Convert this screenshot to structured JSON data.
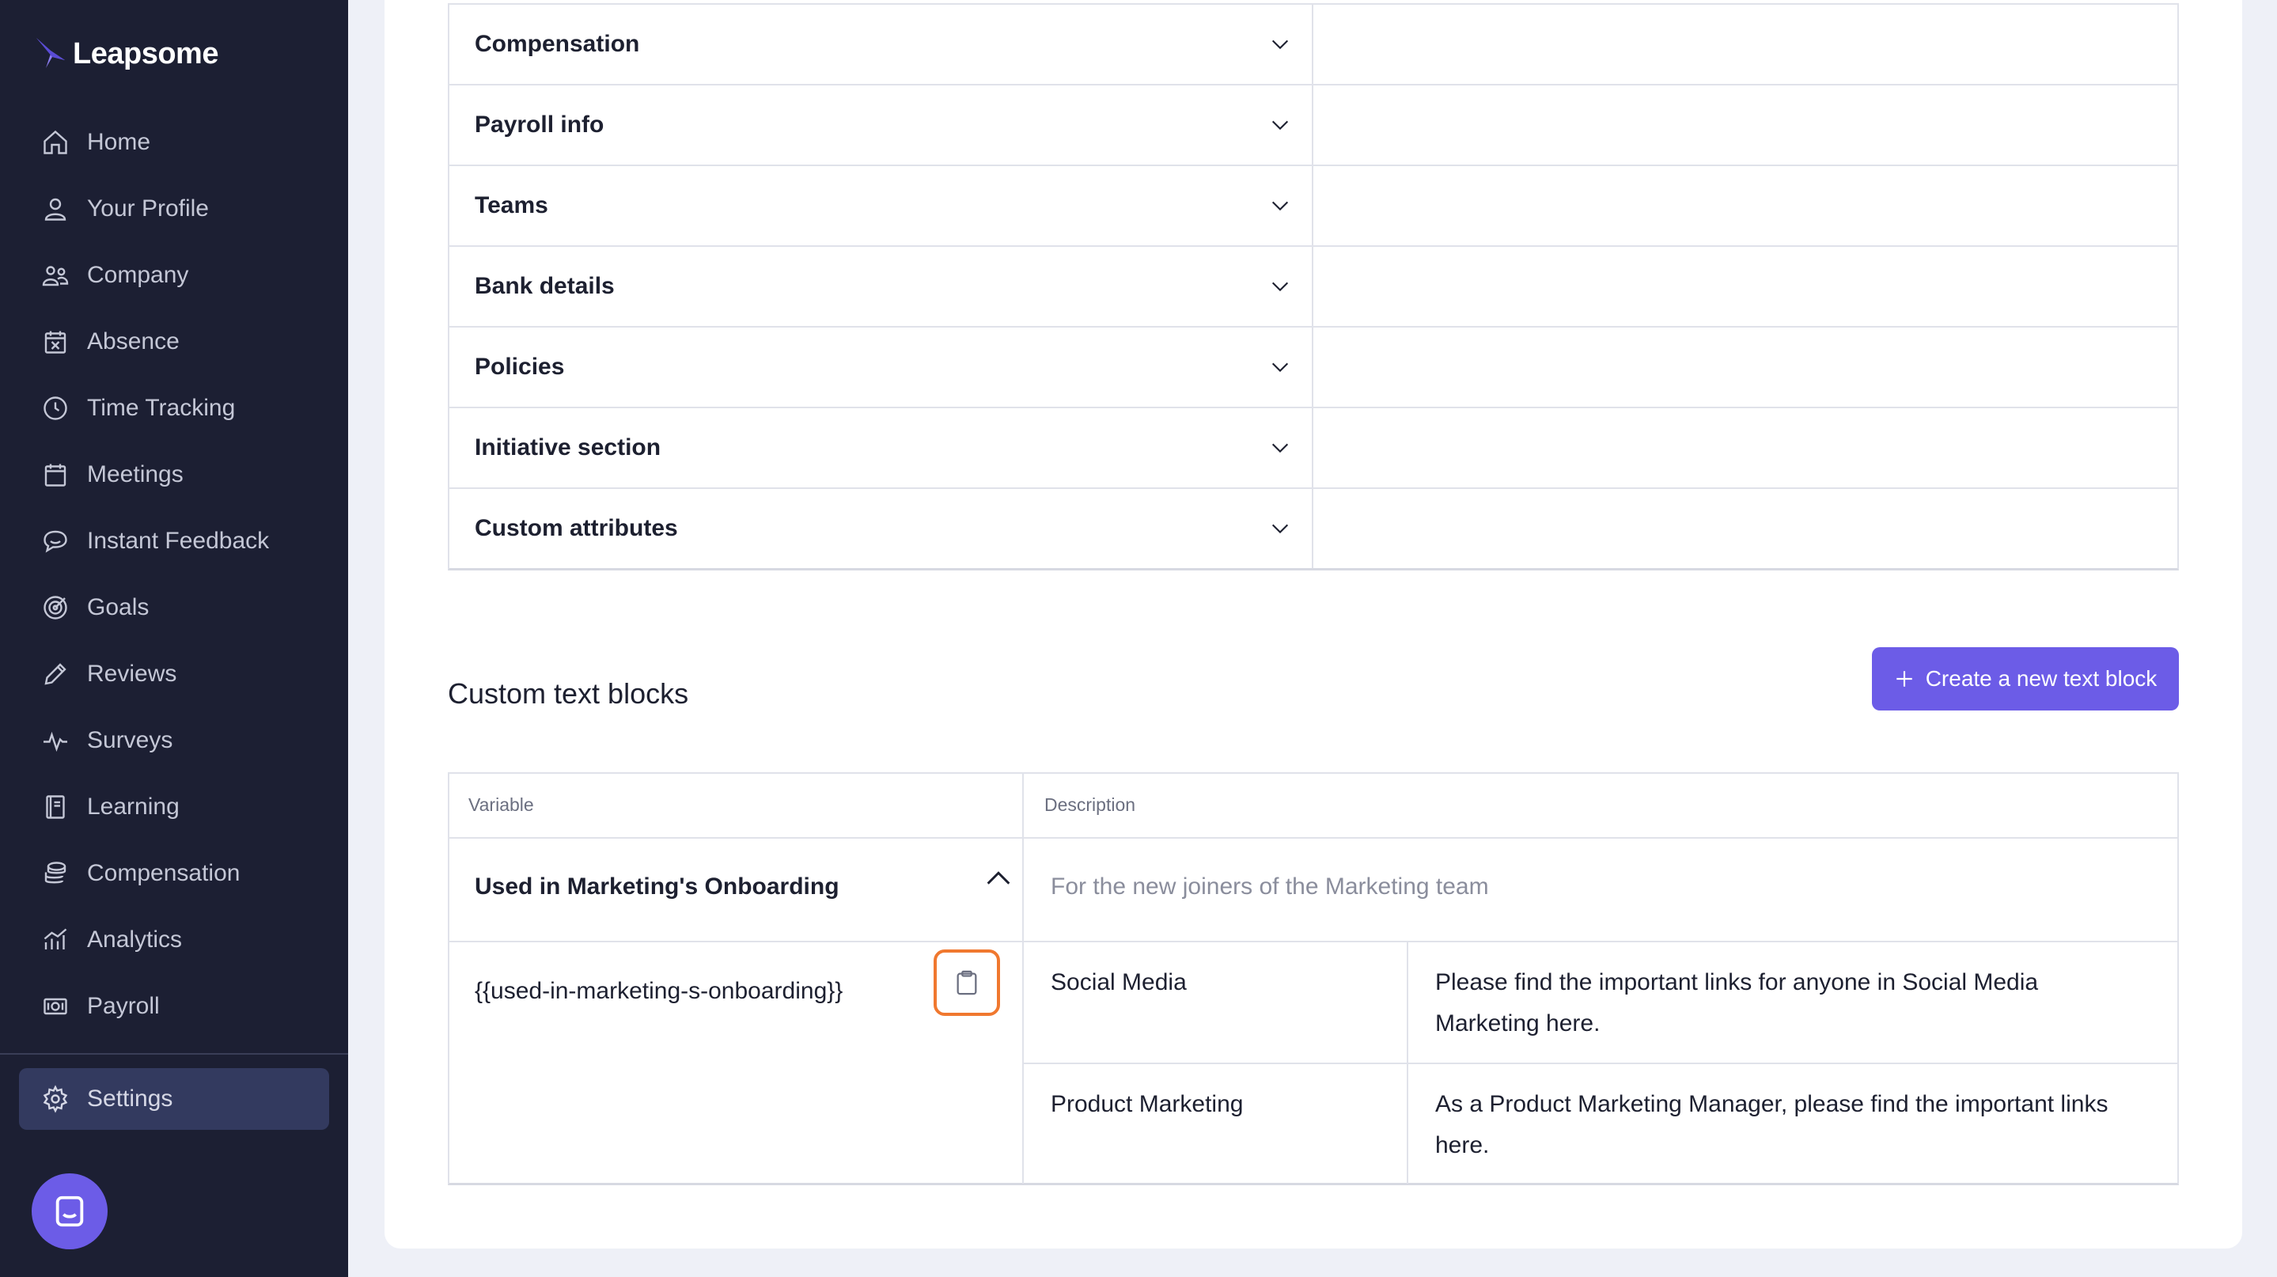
{
  "app": {
    "name": "Leapsome"
  },
  "colors": {
    "accent": "#6c5ce7",
    "sidebar_bg": "#1c1f33",
    "highlight": "#f0782f"
  },
  "sidebar": {
    "items": [
      {
        "label": "Home",
        "icon": "home-icon"
      },
      {
        "label": "Your Profile",
        "icon": "user-icon"
      },
      {
        "label": "Company",
        "icon": "users-icon"
      },
      {
        "label": "Absence",
        "icon": "calendar-x-icon"
      },
      {
        "label": "Time Tracking",
        "icon": "clock-icon"
      },
      {
        "label": "Meetings",
        "icon": "calendar-icon"
      },
      {
        "label": "Instant Feedback",
        "icon": "chat-bubble-icon"
      },
      {
        "label": "Goals",
        "icon": "target-icon"
      },
      {
        "label": "Reviews",
        "icon": "pencil-icon"
      },
      {
        "label": "Surveys",
        "icon": "pulse-icon"
      },
      {
        "label": "Learning",
        "icon": "book-icon"
      },
      {
        "label": "Compensation",
        "icon": "coins-icon"
      },
      {
        "label": "Analytics",
        "icon": "chart-icon"
      },
      {
        "label": "Payroll",
        "icon": "money-icon"
      }
    ],
    "settings": {
      "label": "Settings",
      "icon": "gear-icon"
    },
    "chat_icon": "chat-launcher-icon"
  },
  "sections": [
    {
      "title": "Compensation"
    },
    {
      "title": "Payroll info"
    },
    {
      "title": "Teams"
    },
    {
      "title": "Bank details"
    },
    {
      "title": "Policies"
    },
    {
      "title": "Initiative section"
    },
    {
      "title": "Custom attributes"
    }
  ],
  "custom_text_blocks": {
    "title": "Custom text blocks",
    "create_button": "Create a new text block",
    "columns": {
      "variable": "Variable",
      "description": "Description"
    },
    "blocks": [
      {
        "name": "Used in Marketing's Onboarding",
        "description": "For the new joiners of the Marketing team",
        "variable": "{{used-in-marketing-s-onboarding}}",
        "rows": [
          {
            "team": "Social Media",
            "text_line1": "Please find the important links for anyone in Social Media",
            "text_line2": "Marketing here."
          },
          {
            "team": "Product Marketing",
            "text_line1": "As a Product Marketing Manager, please find the important links",
            "text_line2": "here."
          }
        ]
      }
    ]
  }
}
